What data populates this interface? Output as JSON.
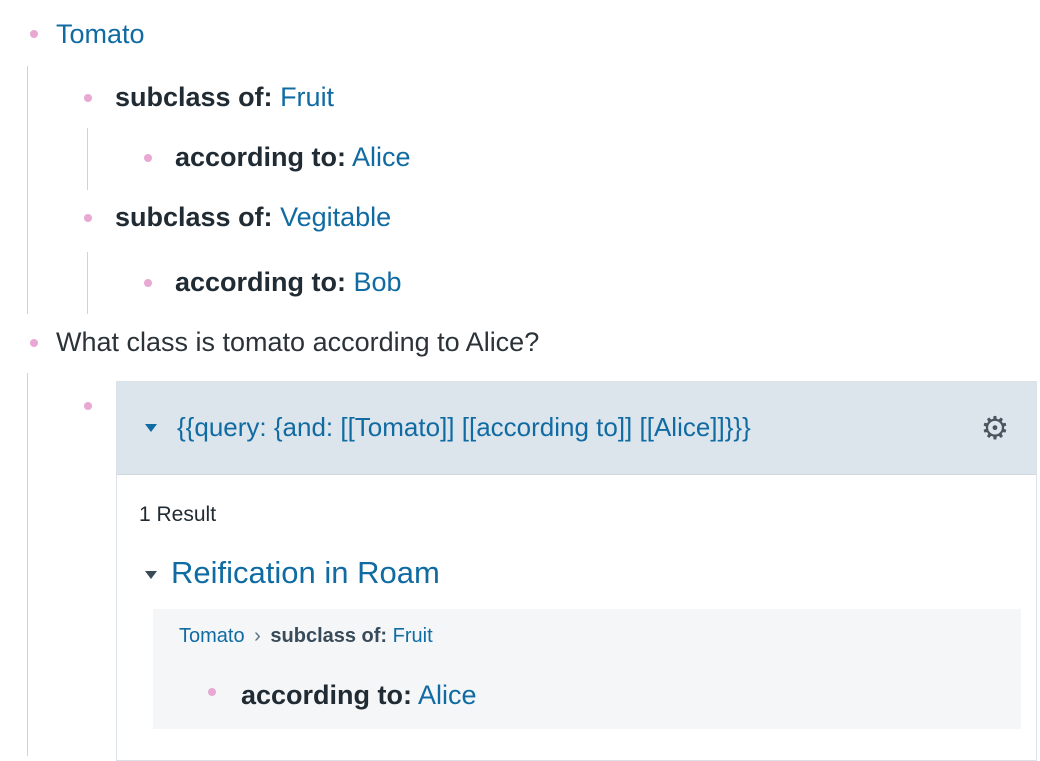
{
  "outline": {
    "tomato": "Tomato",
    "subclass_label": "subclass of:",
    "according_label": "according to:",
    "fruit": "Fruit",
    "alice": "Alice",
    "vegitable": "Vegitable",
    "bob": "Bob",
    "question": "What class is tomato according to Alice?"
  },
  "query": {
    "expression": "{{query:  {and: [[Tomato]] [[according to]] [[Alice]]}}}",
    "result_count": "1 Result",
    "result_page": "Reification in Roam",
    "breadcrumb_root": "Tomato",
    "breadcrumb_sep": "›",
    "breadcrumb_label": "subclass of:",
    "breadcrumb_value": "Fruit",
    "ref_label": "according to:",
    "ref_value": "Alice"
  },
  "colors": {
    "link": "#106ba3",
    "bullet": "#e8a8d2",
    "query_header": "#dde5ec"
  },
  "icons": {
    "query_settings": "gear-icon",
    "collapse": "caret-down-icon",
    "bullets": "bullet-icon"
  }
}
